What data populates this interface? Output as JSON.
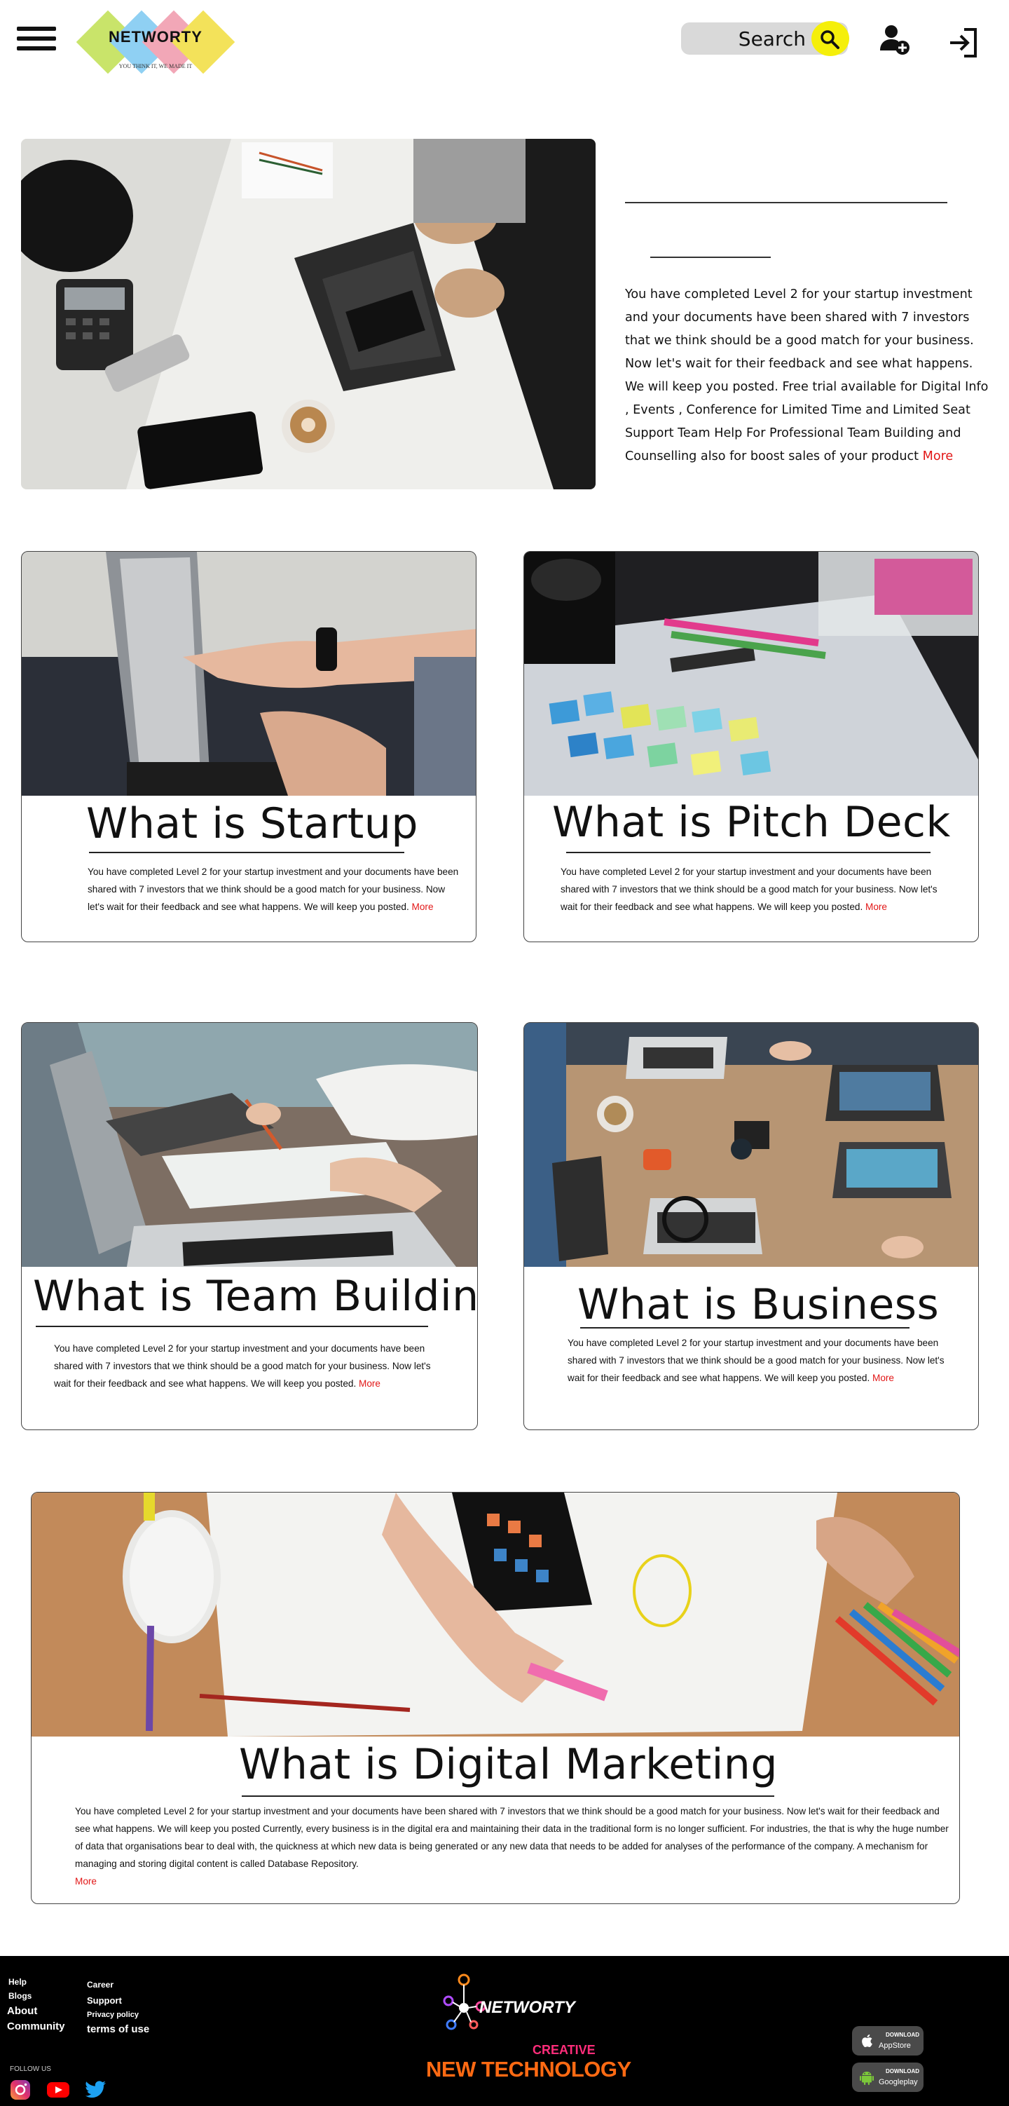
{
  "header": {
    "brand": "NETWORTY",
    "tagline": "YOU THINK IT, WE MADE IT",
    "search_placeholder": "Search",
    "icons": [
      "menu-icon",
      "search-icon",
      "add-user-icon",
      "login-icon"
    ]
  },
  "hero": {
    "text": "You have completed Level 2 for your startup investment and your documents have been shared with 7 investors that we think should be a good match for your business. Now let's wait for their feedback and see what happens. We will keep you posted. Free trial available for Digital Info , Events , Conference for Limited Time and Limited Seat Support Team Help For Professional Team Building and Counselling also for boost sales of your product",
    "more": "More"
  },
  "cards": [
    {
      "title": "What is Startup",
      "text": "You have completed Level 2 for your startup investment and your documents have been shared with 7 investors that we think should be a good match for your business. Now let's wait for their feedback and see what happens. We will keep you posted.",
      "more": "More"
    },
    {
      "title": "What is Pitch Deck",
      "text": "You have completed Level 2 for your startup investment and your documents have been shared with 7 investors that we think should be a good match for your business. Now let's wait for their feedback and see what happens. We will keep you posted.",
      "more": "More"
    },
    {
      "title": "What is Team Building",
      "text": "You have completed Level 2 for your startup investment and your documents have been shared with 7 investors that we think should be a good match for your business. Now let's wait for their feedback and see what happens. We will keep you posted.",
      "more": "More"
    },
    {
      "title": "What is Business",
      "text": "You have completed Level 2 for your startup investment and your documents have been shared with 7 investors that we think should be a good match for your business. Now let's wait for their feedback and see what happens. We will keep you posted.",
      "more": "More"
    },
    {
      "title": "What is Digital Marketing",
      "text": "You have completed Level 2 for your startup investment and your documents have been shared with 7 investors that we think should be a good match for your business. Now let's wait for their feedback and see what happens. We will keep you posted Currently, every business is in the digital era and maintaining their data in the traditional form is no longer sufficient. For industries, the that is why the huge number of data that organisations bear to deal with, the quickness at which new data is being generated or any new data that needs to be added for analyses of the performance of the company. A mechanism for managing and storing digital content is called Database Repository.",
      "more": "More"
    }
  ],
  "footer": {
    "links_col1": [
      "Help",
      "Blogs",
      "About",
      "Community"
    ],
    "links_col2": [
      "Career",
      "Support",
      "Privacy policy",
      "terms of use"
    ],
    "follow_us": "FOLLOW US",
    "social_icons": [
      "instagram-icon",
      "youtube-icon",
      "twitter-icon"
    ],
    "brand": "NETWORTY",
    "creative": "CREATIVE",
    "new_tech": "NEW TECHNOLOGY",
    "stores": [
      {
        "top": "DOWNLOAD",
        "bottom": "AppStore",
        "icon": "apple-icon"
      },
      {
        "top": "DOWNLOAD",
        "bottom": "Googleplay",
        "icon": "android-icon"
      }
    ]
  },
  "colors": {
    "accent_red": "#e21717",
    "search_button": "#f5ef0a",
    "footer_bg": "#000000",
    "footer_brand_orange": "#ff6a13",
    "footer_brand_pink": "#ff2d7a"
  }
}
